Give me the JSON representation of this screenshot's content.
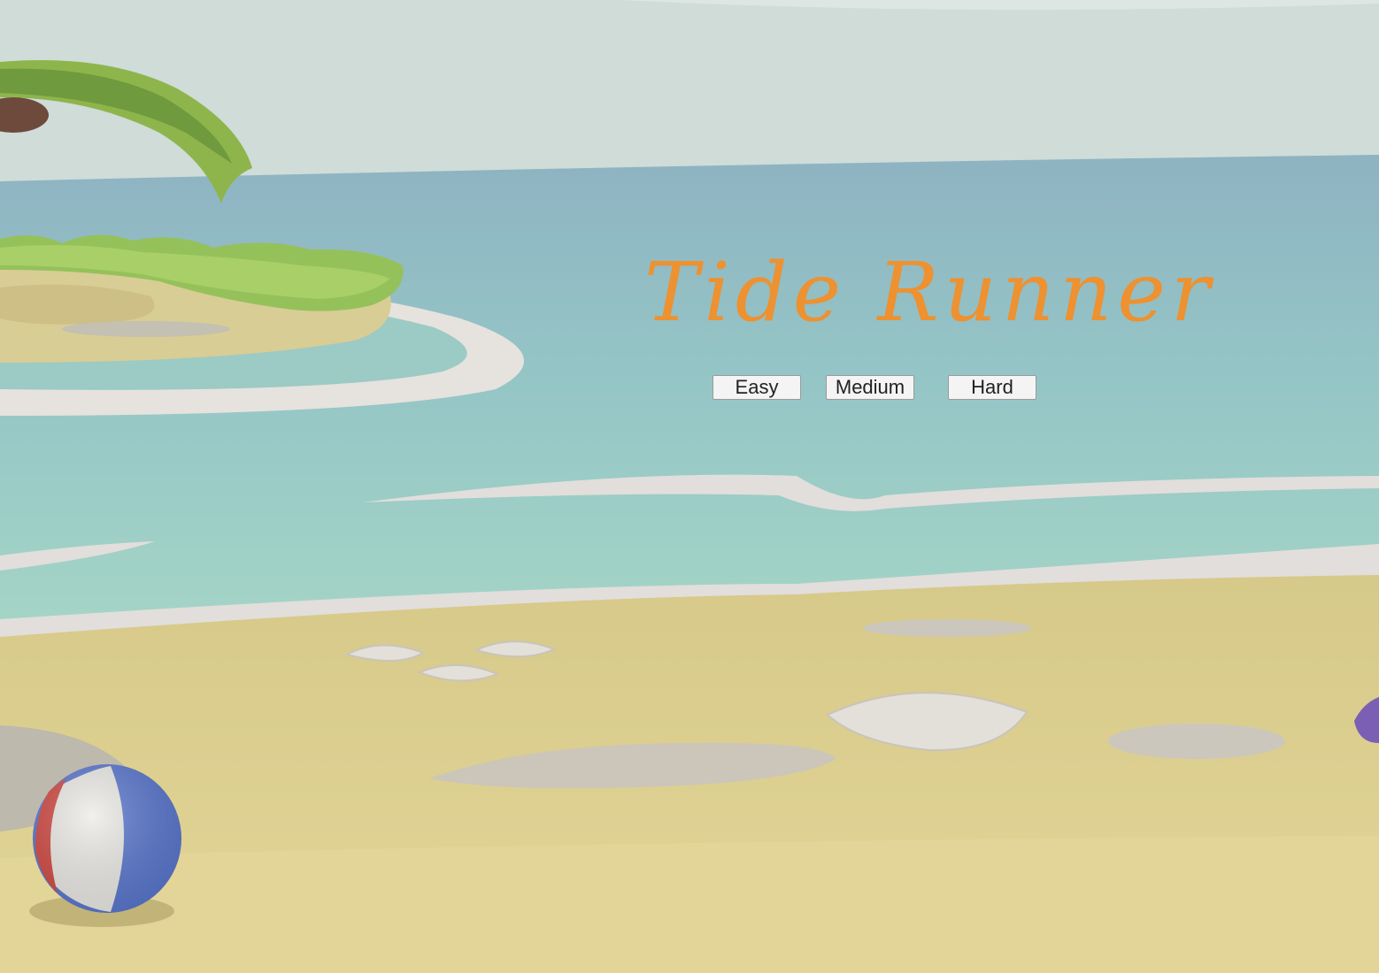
{
  "title": "Tide Runner",
  "menu": {
    "easy_label": "Easy",
    "medium_label": "Medium",
    "hard_label": "Hard"
  },
  "colors": {
    "title": "#ee9130",
    "sky": "#cfdcd8",
    "sea": "#8eb6c1",
    "shallow": "#a3d3c7",
    "sand": "#e0d292",
    "foam": "#e2dedb"
  },
  "scene": {
    "objects": [
      "palm-tree",
      "island",
      "seashells",
      "pebbles",
      "beach-ball"
    ]
  }
}
